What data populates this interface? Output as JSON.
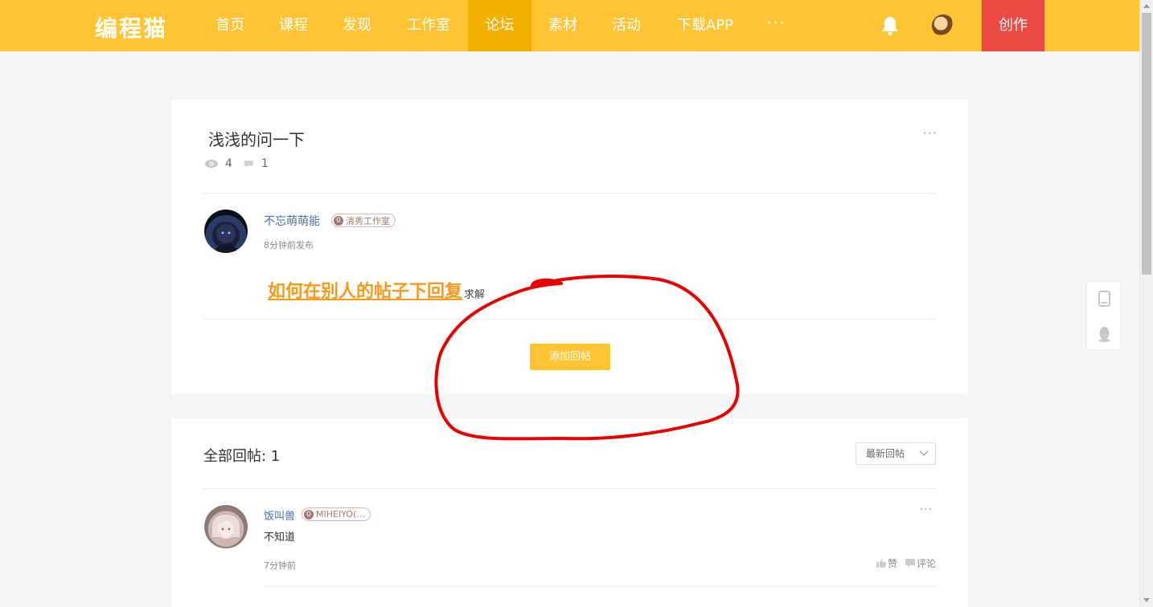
{
  "nav": {
    "logo": "编程猫",
    "items": [
      {
        "label": "首页",
        "active": false
      },
      {
        "label": "课程",
        "active": false
      },
      {
        "label": "发现",
        "active": false
      },
      {
        "label": "工作室",
        "active": false
      },
      {
        "label": "论坛",
        "active": true
      },
      {
        "label": "素材",
        "active": false
      },
      {
        "label": "活动",
        "active": false
      },
      {
        "label": "下载APP",
        "active": false
      }
    ],
    "more": "···",
    "create": "创作",
    "icons": [
      "bell-icon",
      "user-avatar"
    ]
  },
  "post": {
    "title": "浅浅的问一下",
    "more": "···",
    "views": "4",
    "comments": "1",
    "author": {
      "name": "不忘萌萌能",
      "badge_level": "0",
      "badge_text": "清秀工作室",
      "time": "8分钟前发布"
    },
    "body_link": "如何在别人的帖子下回复",
    "body_tail": "求解",
    "add_reply": "添加回帖"
  },
  "replies": {
    "title": "全部回帖: 1",
    "sort": "最新回帖",
    "items": [
      {
        "name": "饭叫兽",
        "badge_level": "0",
        "badge_text": "MIHEIYO(...",
        "text": "不知道",
        "time": "7分钟前",
        "like": "赞",
        "comment": "评论",
        "more": "···"
      }
    ]
  },
  "colors": {
    "brand": "#fec433",
    "nav_active": "#f4b000",
    "create": "#ee4a44",
    "link": "#f59a1a",
    "annotation": "#e60000"
  }
}
